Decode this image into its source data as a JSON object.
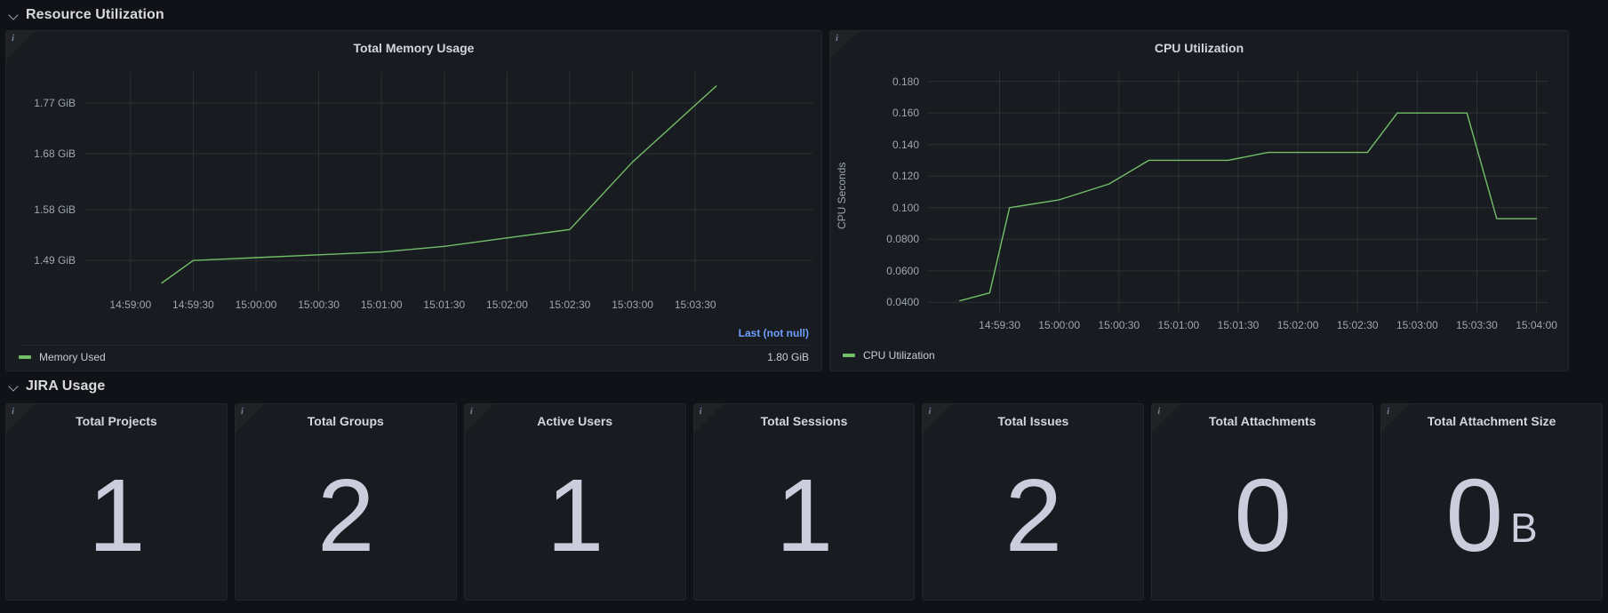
{
  "sections": [
    {
      "id": "resource-utilization",
      "title": "Resource Utilization",
      "chevron_icon": "chevron-down-icon"
    },
    {
      "id": "jira-usage",
      "title": "JIRA Usage",
      "chevron_icon": "chevron-down-icon"
    }
  ],
  "panels": {
    "memory": {
      "title": "Total Memory Usage",
      "info_icon": "info-icon",
      "legend": {
        "header": "Last (not null)",
        "series_name": "Memory Used",
        "series_value": "1.80 GiB",
        "color": "#73bf69"
      }
    },
    "cpu": {
      "title": "CPU Utilization",
      "info_icon": "info-icon",
      "legend": {
        "series_name": "CPU Utilization",
        "color": "#73bf69"
      }
    }
  },
  "stats": [
    {
      "title": "Total Projects",
      "value": "1",
      "unit": "",
      "info_icon": "info-icon"
    },
    {
      "title": "Total Groups",
      "value": "2",
      "unit": "",
      "info_icon": "info-icon"
    },
    {
      "title": "Active Users",
      "value": "1",
      "unit": "",
      "info_icon": "info-icon"
    },
    {
      "title": "Total Sessions",
      "value": "1",
      "unit": "",
      "info_icon": "info-icon"
    },
    {
      "title": "Total Issues",
      "value": "2",
      "unit": "",
      "info_icon": "info-icon"
    },
    {
      "title": "Total Attachments",
      "value": "0",
      "unit": "",
      "info_icon": "info-icon"
    },
    {
      "title": "Total Attachment Size",
      "value": "0",
      "unit": "B",
      "info_icon": "info-icon"
    }
  ],
  "chart_data": [
    {
      "id": "memory",
      "type": "line",
      "title": "Total Memory Usage",
      "xlabel": "",
      "ylabel": "",
      "grid": true,
      "legend_position": "bottom",
      "color": "#73bf69",
      "series": [
        {
          "name": "Memory Used",
          "x": [
            "14:59:15",
            "14:59:30",
            "15:00:00",
            "15:00:30",
            "15:01:00",
            "15:01:30",
            "15:02:00",
            "15:02:30",
            "15:03:00",
            "15:03:40"
          ],
          "values": [
            1.45,
            1.49,
            1.495,
            1.5,
            1.505,
            1.515,
            1.53,
            1.545,
            1.665,
            1.8
          ]
        }
      ],
      "ytick_labels": [
        "1.77 GiB",
        "1.68 GiB",
        "1.58 GiB",
        "1.49 GiB"
      ],
      "ytick_values": [
        1.77,
        1.68,
        1.58,
        1.49
      ],
      "ylim": [
        1.435,
        1.825
      ],
      "xtick_labels": [
        "14:59:00",
        "14:59:30",
        "15:00:00",
        "15:00:30",
        "15:01:00",
        "15:01:30",
        "15:02:00",
        "15:02:30",
        "15:03:00",
        "15:03:30"
      ]
    },
    {
      "id": "cpu",
      "type": "line",
      "title": "CPU Utilization",
      "xlabel": "",
      "ylabel": "CPU Seconds",
      "grid": true,
      "legend_position": "bottom",
      "color": "#73bf69",
      "series": [
        {
          "name": "CPU Utilization",
          "x": [
            "14:59:10",
            "14:59:25",
            "14:59:35",
            "15:00:00",
            "15:00:25",
            "15:00:45",
            "15:01:10",
            "15:01:25",
            "15:01:45",
            "15:02:15",
            "15:02:35",
            "15:02:50",
            "15:03:25",
            "15:03:40",
            "15:04:00"
          ],
          "values": [
            0.041,
            0.046,
            0.1,
            0.105,
            0.115,
            0.13,
            0.13,
            0.13,
            0.135,
            0.135,
            0.135,
            0.16,
            0.16,
            0.093,
            0.093
          ]
        }
      ],
      "ytick_labels": [
        "0.180",
        "0.160",
        "0.140",
        "0.120",
        "0.100",
        "0.0800",
        "0.0600",
        "0.0400"
      ],
      "ytick_values": [
        0.18,
        0.16,
        0.14,
        0.12,
        0.1,
        0.08,
        0.06,
        0.04
      ],
      "ylim": [
        0.034,
        0.186
      ],
      "xtick_labels": [
        "14:59:30",
        "15:00:00",
        "15:00:30",
        "15:01:00",
        "15:01:30",
        "15:02:00",
        "15:02:30",
        "15:03:00",
        "15:03:30",
        "15:04:00"
      ]
    }
  ]
}
